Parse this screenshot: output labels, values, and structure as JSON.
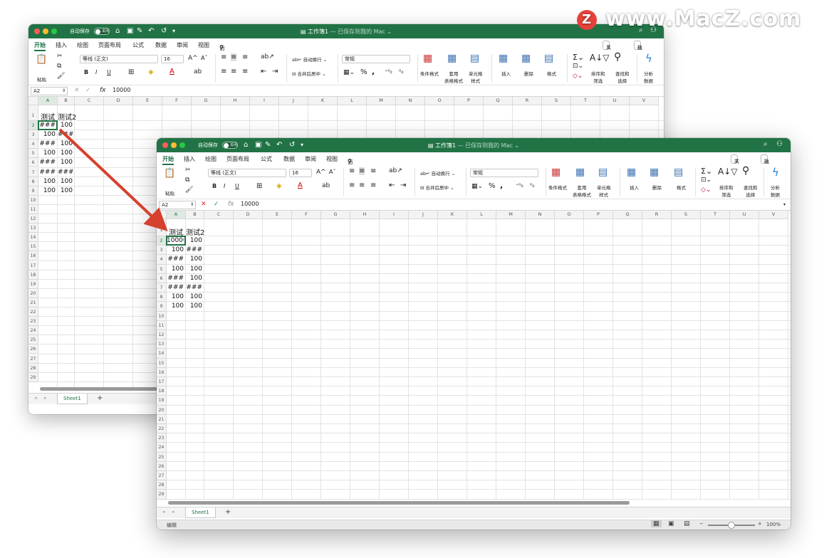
{
  "watermark": {
    "badge": "Z",
    "text": "www.MacZ.com"
  },
  "titlebar": {
    "autosave_label": "自动保存",
    "autosave_state": "关闭",
    "title": "工作簿1",
    "title_suffix": "— 已保存到我的 Mac ⌄"
  },
  "tabs": [
    "开始",
    "插入",
    "绘图",
    "页面布局",
    "公式",
    "数据",
    "审阅",
    "视图",
    "告诉我"
  ],
  "share": {
    "share_label": "共享",
    "comment_label": "批注"
  },
  "ribbon": {
    "paste": "粘贴",
    "font_name": "等线 (正文)",
    "font_size": "16",
    "bold": "B",
    "italic": "I",
    "underline": "U",
    "wrap_text": "自动换行",
    "merge_center": "合并后居中",
    "number_format": "常规",
    "percent": "%",
    "comma": ",",
    "cond_format": "条件格式",
    "table_format": "套用\n表格格式",
    "cell_style": "单元格\n样式",
    "insert": "插入",
    "delete": "删除",
    "format": "格式",
    "sort_filter": "排序和\n筛选",
    "find_select": "查找和\n选择",
    "analyze": "分析\n数据"
  },
  "formula": {
    "namebox": "A2",
    "fx": "fx",
    "value": "10000"
  },
  "columns": [
    "A",
    "B",
    "C",
    "D",
    "E",
    "F",
    "G",
    "H",
    "I",
    "J",
    "K",
    "L",
    "M",
    "N",
    "O",
    "P",
    "Q",
    "R",
    "S",
    "T",
    "U",
    "V"
  ],
  "window1_cells": {
    "header": [
      "测试",
      "测试2"
    ],
    "colA": [
      "###",
      "100",
      "###",
      "100",
      "###",
      "###",
      "100",
      "100"
    ],
    "colB": [
      "100",
      "###",
      "100",
      "100",
      "100",
      "###",
      "100",
      "100"
    ]
  },
  "window2_cells": {
    "header": [
      "测试",
      "测试2"
    ],
    "colA": [
      "10000",
      "100",
      "###",
      "100",
      "###",
      "###",
      "100",
      "100"
    ],
    "colB": [
      "100",
      "###",
      "100",
      "100",
      "100",
      "###",
      "100",
      "100"
    ]
  },
  "sheet": {
    "name": "Sheet1",
    "add": "+"
  },
  "status": {
    "mode": "编辑",
    "zoom": "100%",
    "minus": "−",
    "plus": "+"
  },
  "colors": {
    "excel_green": "#217346",
    "arrow_red": "#d6402e"
  }
}
